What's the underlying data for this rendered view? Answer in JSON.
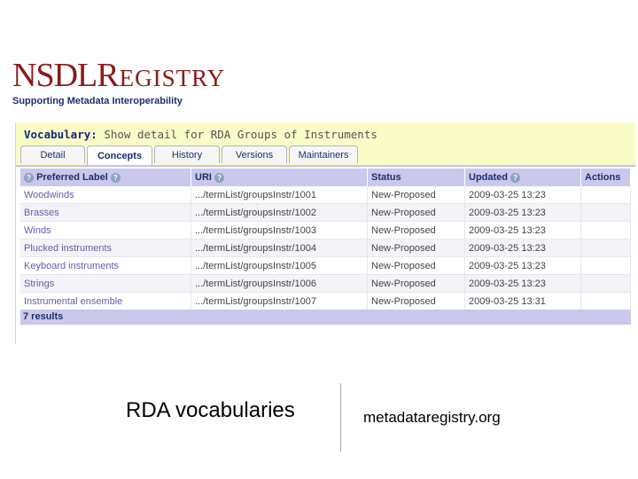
{
  "logo": {
    "part1": "NSDL",
    "part2": "R",
    "part3": "EGISTRY"
  },
  "tagline": "Supporting Metadata Interoperability",
  "vocabulary": {
    "label": "Vocabulary:",
    "title": "Show detail for RDA Groups of Instruments"
  },
  "tabs": [
    {
      "label": "Detail",
      "active": false
    },
    {
      "label": "Concepts",
      "active": true
    },
    {
      "label": "History",
      "active": false
    },
    {
      "label": "Versions",
      "active": false
    },
    {
      "label": "Maintainers",
      "active": false
    }
  ],
  "table": {
    "headers": {
      "pref": "Preferred Label",
      "uri": "URI",
      "status": "Status",
      "updated": "Updated",
      "actions": "Actions"
    },
    "help_icon": "question-circle-icon",
    "rows": [
      {
        "label": "Woodwinds",
        "uri": ".../termList/groupsInstr/1001",
        "status": "New-Proposed",
        "updated": "2009-03-25 13:23"
      },
      {
        "label": "Brasses",
        "uri": ".../termList/groupsInstr/1002",
        "status": "New-Proposed",
        "updated": "2009-03-25 13:23"
      },
      {
        "label": "Winds",
        "uri": ".../termList/groupsInstr/1003",
        "status": "New-Proposed",
        "updated": "2009-03-25 13:23"
      },
      {
        "label": "Plucked instruments",
        "uri": ".../termList/groupsInstr/1004",
        "status": "New-Proposed",
        "updated": "2009-03-25 13:23"
      },
      {
        "label": "Keyboard instruments",
        "uri": ".../termList/groupsInstr/1005",
        "status": "New-Proposed",
        "updated": "2009-03-25 13:23"
      },
      {
        "label": "Strings",
        "uri": ".../termList/groupsInstr/1006",
        "status": "New-Proposed",
        "updated": "2009-03-25 13:23"
      },
      {
        "label": "Instrumental ensemble",
        "uri": ".../termList/groupsInstr/1007",
        "status": "New-Proposed",
        "updated": "2009-03-25 13:31"
      }
    ]
  },
  "results": "7 results",
  "caption_left": "RDA vocabularies",
  "caption_right": "metadataregistry.org",
  "colors": {
    "logo": "#8b1a1a",
    "header_bg": "#fafcc8",
    "table_header": "#cac8ec",
    "link": "#6a5aa8"
  }
}
